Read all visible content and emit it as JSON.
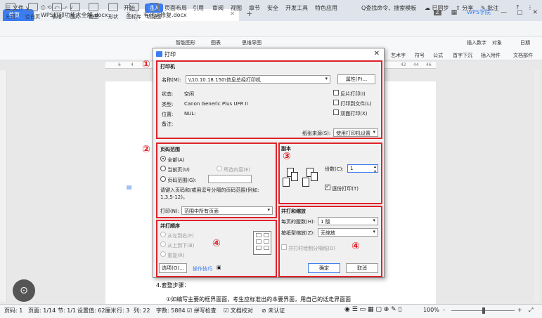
{
  "tabs": {
    "home": "首页",
    "doc1": "WPS打印功能大全解.docx",
    "doc2": "有代词修复.docx",
    "new_tab": "+"
  },
  "window": {
    "badge": "WPS学院",
    "user_badge": "Z"
  },
  "menubar": {
    "file_menu": "☰ 文件 ∨",
    "items": [
      "开始",
      "插入",
      "页面布局",
      "引用",
      "审阅",
      "视图",
      "章节",
      "安全",
      "开发工具",
      "特色应用"
    ],
    "active_item": "插入",
    "search": "Q查找命令、搜索模板",
    "sync": "已同步",
    "share": "分享",
    "comment": "批注",
    "help": "?"
  },
  "ribbon": {
    "items": [
      "分页",
      "空白页",
      "表格",
      "图片",
      "截图",
      "形状",
      "图标库",
      "功能图"
    ],
    "mid_items": [
      "智能图形",
      "图表",
      "思维导图"
    ],
    "right_items": [
      "艺术字",
      "符号",
      "公式",
      "首字下沉",
      "插入数字",
      "对象",
      "插入附件",
      "日期",
      "文档部件"
    ]
  },
  "ruler": {
    "marks": [
      "6",
      "4",
      "42",
      "44",
      "46"
    ]
  },
  "doc": {
    "line1": "4.套整步骤：",
    "line2": "①如编写主要的框界面面，考生应标准出的本要界面，用自己的话走界面面"
  },
  "dialog": {
    "title": "打印",
    "close": "✕",
    "section1": {
      "group_label": "打印机",
      "name_label": "名称(M):",
      "printer_name": "\\\\10.10.18.150\\信息总经打印机",
      "properties_button": "属性(P)...",
      "status_label": "状态:",
      "status_value": "空闲",
      "type_label": "类型:",
      "type_value": "Canon Generic Plus UFR II",
      "location_label": "位置:",
      "location_value": "NUL:",
      "remark_label": "备注:",
      "reverse_print": "反片打印(I)",
      "print_to_file": "打印到文件(L)",
      "duplex_print": "双面打印(X)",
      "paper_source_label": "纸张来源(S):",
      "paper_source_value": "使用打印机设置"
    },
    "section2": {
      "group_label": "页码范围",
      "all": "全部(A)",
      "current_page": "当前页(U)",
      "selection": "所选内容(E)",
      "page_range": "页码范围(G):",
      "hint": "请键入页码和/或用逗号分隔的页码范围(例如: 1,3,5-12)。",
      "print_label": "打印(N):",
      "print_value": "范围中所有页面"
    },
    "section3": {
      "group_label": "副本",
      "copies_label": "份数(C):",
      "copies_value": "1",
      "collate": "逐份打印(T)"
    },
    "section4_left": {
      "group_label": "并打顺序",
      "left_to_right": "从左到右(F)",
      "top_to_bottom": "从上到下(B)",
      "repeat": "重复(R)",
      "options_button": "选项(O)...",
      "tips_link": "操作技巧"
    },
    "section4_right": {
      "group_label": "并打和缩放",
      "pages_per_sheet_label": "每页的版数(H):",
      "pages_per_sheet_value": "1 版",
      "scale_label": "按纸型缩放(Z):",
      "scale_value": "无缩放",
      "draw_border": "并打时绘制分隔线(D)"
    },
    "ok_button": "确定",
    "cancel_button": "取消",
    "annotations": [
      "①",
      "②",
      "③",
      "④",
      "④"
    ]
  },
  "statusbar": {
    "page": "页码: 1",
    "pages": "页面: 1/14",
    "section": "节: 1/1",
    "setting": "设置值: 62厘米",
    "row": "行: 3",
    "col": "列: 22",
    "words": "字数: 5884",
    "spell": "拼写检查",
    "proof": "文档校对",
    "cert": "未认证",
    "zoom": "100%",
    "zoom_minus": "-",
    "zoom_plus": "+"
  },
  "colors": {
    "accent": "#3b7cf0",
    "annotation": "#e0222a"
  }
}
